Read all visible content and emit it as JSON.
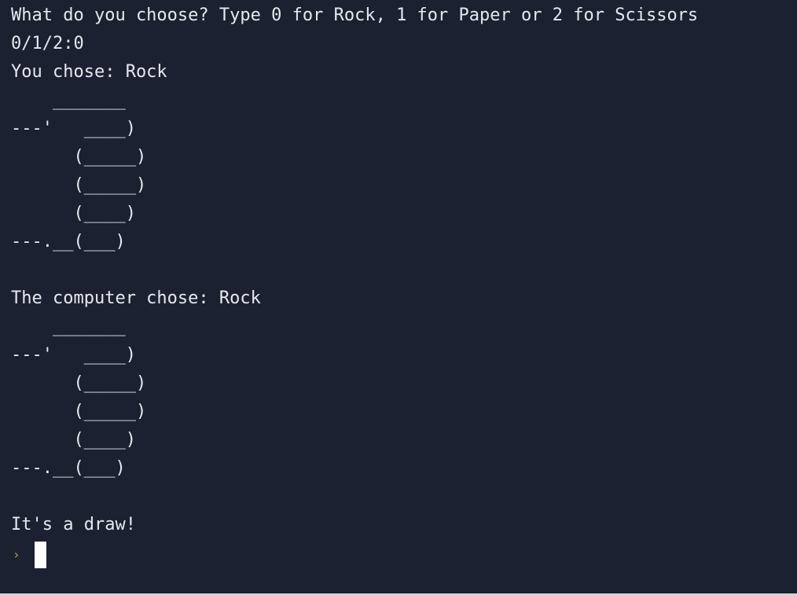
{
  "terminal": {
    "lines": [
      "What do you choose? Type 0 for Rock, 1 for Paper or 2 for Scissors",
      "0/1/2:0",
      "You chose: Rock"
    ],
    "user_art": [
      "    _______",
      "---'   ____)",
      "      (_____)",
      "      (_____)",
      "      (____)",
      "---.__(___)",
      ""
    ],
    "computer_label": "The computer chose: Rock",
    "computer_art": [
      "    _______",
      "---'   ____)",
      "      (_____)",
      "      (_____)",
      "      (____)",
      "---.__(___)",
      ""
    ],
    "result": "It's a draw!",
    "prompt_symbol": "›"
  },
  "colors": {
    "background": "#1c2131",
    "text": "#e6e8ee",
    "prompt": "#c7a12e",
    "cursor": "#ffffff"
  }
}
